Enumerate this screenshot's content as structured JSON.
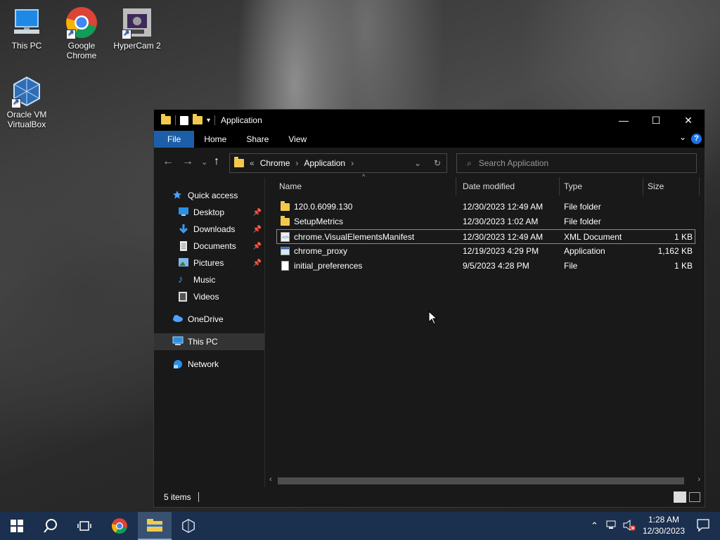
{
  "desktop": {
    "icons": [
      {
        "label": "This PC",
        "icon": "computer-icon"
      },
      {
        "label": "Google\nChrome",
        "icon": "chrome-icon"
      },
      {
        "label": "HyperCam 2",
        "icon": "hypercam-icon"
      },
      {
        "label": "Oracle VM\nVirtualBox",
        "icon": "virtualbox-icon"
      }
    ]
  },
  "window": {
    "title": "Application",
    "controls": {
      "minimize": "—",
      "maximize": "☐",
      "close": "✕"
    },
    "ribbon_tabs": [
      "File",
      "Home",
      "Share",
      "View"
    ],
    "help_label": "?",
    "breadcrumb": {
      "chevron": "«",
      "parts": [
        "Chrome",
        "Application"
      ]
    },
    "search_placeholder": "Search Application",
    "nav_pane": [
      {
        "label": "Quick access",
        "icon": "star-icon",
        "pinned": false
      },
      {
        "label": "Desktop",
        "icon": "desktop-icon",
        "pinned": true
      },
      {
        "label": "Downloads",
        "icon": "download-icon",
        "pinned": true
      },
      {
        "label": "Documents",
        "icon": "documents-icon",
        "pinned": true
      },
      {
        "label": "Pictures",
        "icon": "pictures-icon",
        "pinned": true
      },
      {
        "label": "Music",
        "icon": "music-icon",
        "pinned": false
      },
      {
        "label": "Videos",
        "icon": "videos-icon",
        "pinned": false
      },
      {
        "label": "OneDrive",
        "icon": "cloud-icon",
        "pinned": false
      },
      {
        "label": "This PC",
        "icon": "computer-icon",
        "pinned": false
      },
      {
        "label": "Network",
        "icon": "network-icon",
        "pinned": false
      }
    ],
    "columns": [
      "Name",
      "Date modified",
      "Type",
      "Size"
    ],
    "files": [
      {
        "name": "120.0.6099.130",
        "date": "12/30/2023 12:49 AM",
        "type": "File folder",
        "size": "",
        "icon": "folder-icon"
      },
      {
        "name": "SetupMetrics",
        "date": "12/30/2023 1:02 AM",
        "type": "File folder",
        "size": "",
        "icon": "folder-icon"
      },
      {
        "name": "chrome.VisualElementsManifest",
        "date": "12/30/2023 12:49 AM",
        "type": "XML Document",
        "size": "1 KB",
        "icon": "xml-file-icon"
      },
      {
        "name": "chrome_proxy",
        "date": "12/19/2023 4:29 PM",
        "type": "Application",
        "size": "1,162 KB",
        "icon": "application-icon"
      },
      {
        "name": "initial_preferences",
        "date": "9/5/2023 4:28 PM",
        "type": "File",
        "size": "1 KB",
        "icon": "file-icon"
      }
    ],
    "status": "5 items"
  },
  "taskbar": {
    "clock_time": "1:28 AM",
    "clock_date": "12/30/2023"
  },
  "colors": {
    "accent": "#1c5fa8",
    "folder": "#f3c94c",
    "taskbar": "#1b2f4e"
  }
}
